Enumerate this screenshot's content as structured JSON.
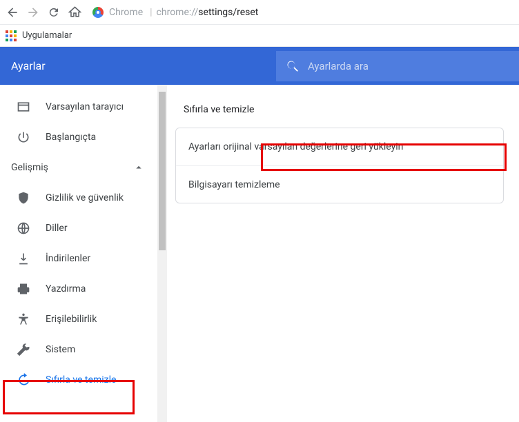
{
  "url": {
    "pre": "chrome://",
    "main": "settings/reset",
    "label": "Chrome"
  },
  "bookmarks": {
    "apps": "Uygulamalar"
  },
  "header": {
    "title": "Ayarlar",
    "search_placeholder": "Ayarlarda ara"
  },
  "sidebar": {
    "basic": [
      {
        "label": "Varsayılan tarayıcı"
      },
      {
        "label": "Başlangıçta"
      }
    ],
    "advanced_header": "Gelişmiş",
    "advanced": [
      {
        "label": "Gizlilik ve güvenlik"
      },
      {
        "label": "Diller"
      },
      {
        "label": "İndirilenler"
      },
      {
        "label": "Yazdırma"
      },
      {
        "label": "Erişilebilirlik"
      },
      {
        "label": "Sistem"
      },
      {
        "label": "Sıfırla ve temizle"
      }
    ]
  },
  "content": {
    "title": "Sıfırla ve temizle",
    "rows": [
      "Ayarları orijinal varsayılan değerlerine geri yükleyin",
      "Bilgisayarı temizleme"
    ]
  }
}
